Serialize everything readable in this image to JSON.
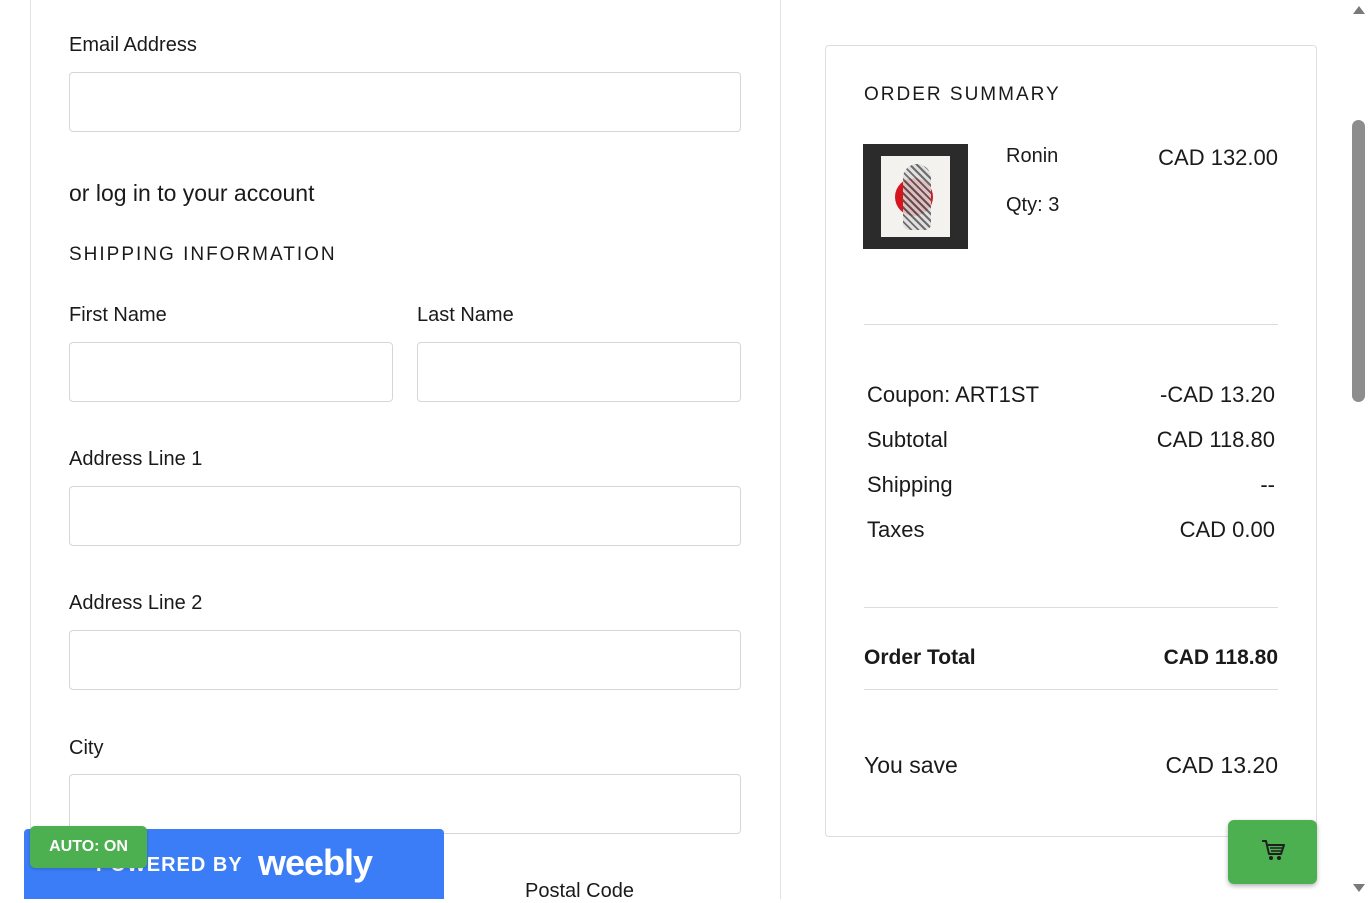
{
  "form": {
    "email_label": "Email Address",
    "email_value": "",
    "login_text": "or log in to your account",
    "shipping_heading": "SHIPPING INFORMATION",
    "first_name_label": "First Name",
    "first_name_value": "",
    "last_name_label": "Last Name",
    "last_name_value": "",
    "address1_label": "Address Line 1",
    "address1_value": "",
    "address2_label": "Address Line 2",
    "address2_value": "",
    "city_label": "City",
    "city_value": "",
    "postal_label": "Postal Code"
  },
  "summary": {
    "title": "ORDER SUMMARY",
    "item": {
      "name": "Ronin",
      "qty": "Qty: 3",
      "price": "CAD 132.00",
      "image": "ronin-artwork-thumbnail"
    },
    "rows": [
      {
        "label": "Coupon: ART1ST",
        "value": "-CAD 13.20"
      },
      {
        "label": "Subtotal",
        "value": "CAD 118.80"
      },
      {
        "label": "Shipping",
        "value": "--"
      },
      {
        "label": "Taxes",
        "value": "CAD 0.00"
      }
    ],
    "total_label": "Order Total",
    "total_value": "CAD 118.80",
    "save_label": "You save",
    "save_value": "CAD 13.20"
  },
  "footer": {
    "powered_by": "POWERED BY",
    "brand": "weebly",
    "brand_color": "#3a7df6",
    "auto_badge": "AUTO: ON",
    "cart_icon": "cart-icon",
    "accent_green": "#4caf50"
  }
}
